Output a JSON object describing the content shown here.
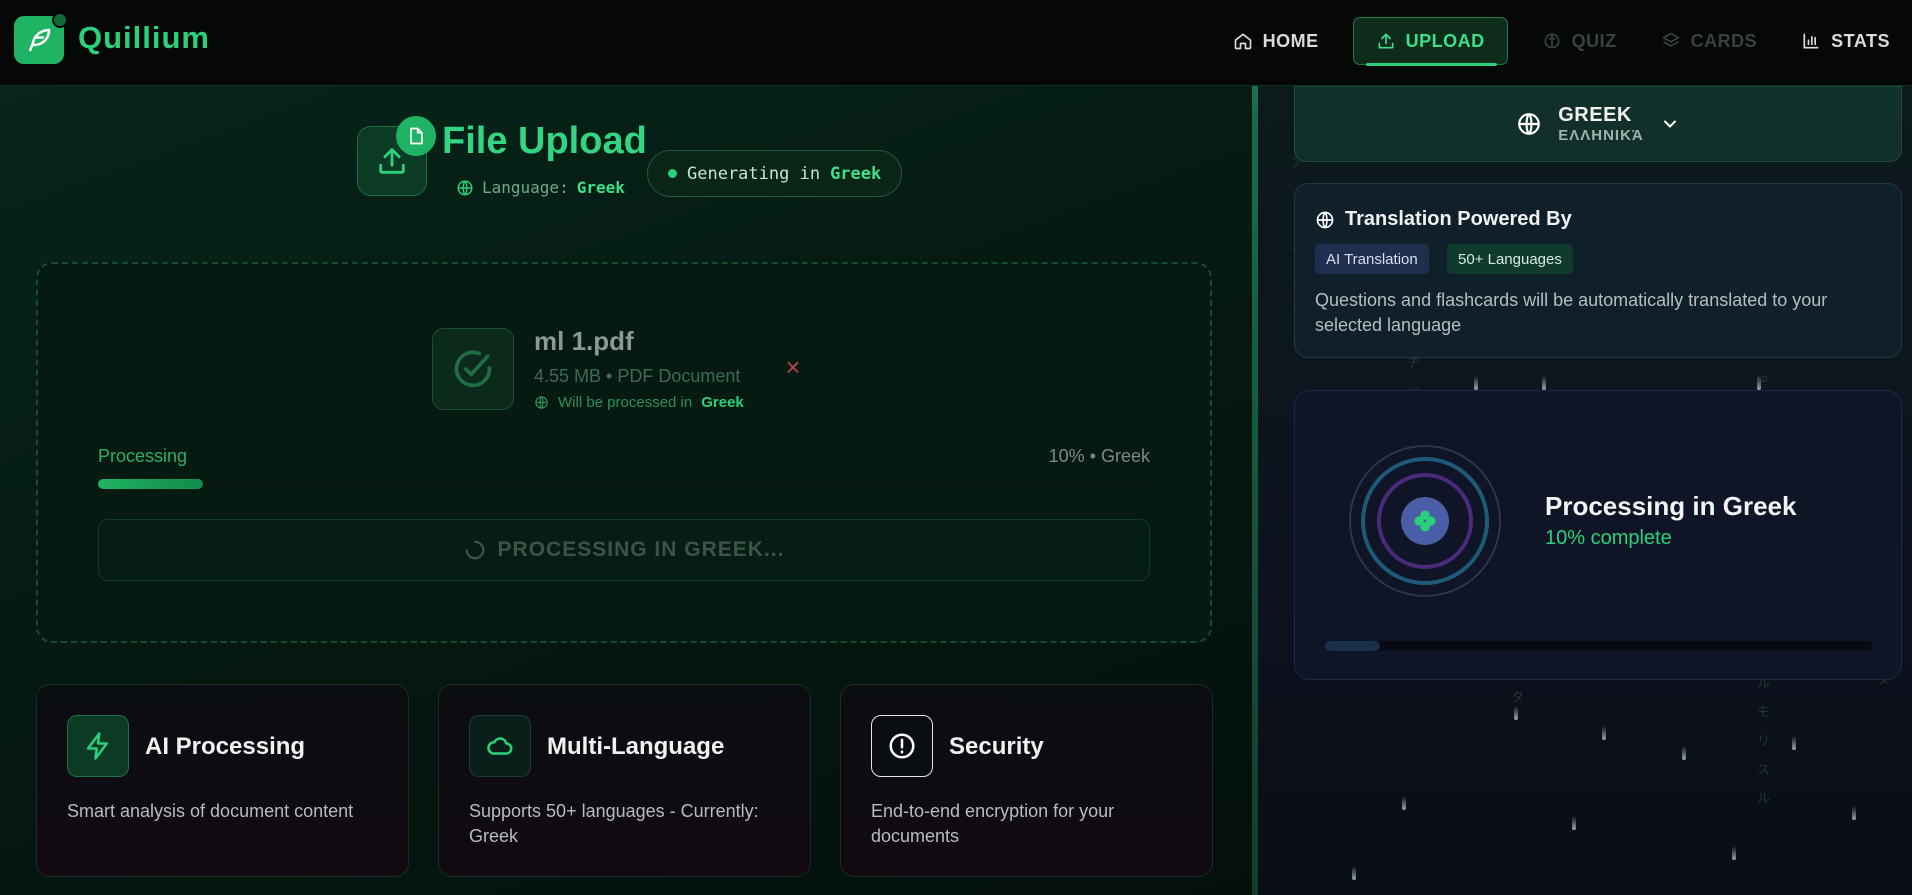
{
  "app": {
    "name": "Quillium"
  },
  "nav": {
    "items": [
      {
        "label": "HOME",
        "icon": "home-icon",
        "state": "normal"
      },
      {
        "label": "UPLOAD",
        "icon": "upload-icon",
        "state": "active"
      },
      {
        "label": "QUIZ",
        "icon": "brain-icon",
        "state": "disabled"
      },
      {
        "label": "CARDS",
        "icon": "layers-icon",
        "state": "disabled"
      },
      {
        "label": "STATS",
        "icon": "bar-chart-icon",
        "state": "normal"
      }
    ]
  },
  "upload": {
    "title": "File Upload",
    "language_prefix": "Language:",
    "language": "Greek",
    "generating_prefix": "Generating in",
    "generating_language": "Greek"
  },
  "file": {
    "name": "ml 1.pdf",
    "meta": "4.55 MB • PDF Document",
    "process_prefix": "Will be processed in",
    "process_language": "Greek"
  },
  "progress": {
    "label": "Processing",
    "status_text": "10% • Greek",
    "fraction": 0.1,
    "button_label": "PROCESSING IN GREEK..."
  },
  "features": [
    {
      "title": "AI Processing",
      "desc": "Smart analysis of document content",
      "icon": "lightning-icon"
    },
    {
      "title": "Multi-Language",
      "desc": "Supports 50+ languages - Currently: Greek",
      "icon": "cloud-icon"
    },
    {
      "title": "Security",
      "desc": "End-to-end encryption for your documents",
      "icon": "alert-circle-icon"
    }
  ],
  "language_selector": {
    "english": "GREEK",
    "native": "ΕΛΛΗΝΙΚΆ"
  },
  "translation": {
    "title": "Translation Powered By",
    "tags": [
      "AI Translation",
      "50+ Languages"
    ],
    "desc": "Questions and flashcards will be automatically translated to your selected language"
  },
  "status": {
    "title": "Processing in Greek",
    "subtitle": "10% complete",
    "fraction": 0.1
  },
  "colors": {
    "accent": "#2bd07a",
    "accent_dark": "#1fb463",
    "danger": "#b04545"
  }
}
